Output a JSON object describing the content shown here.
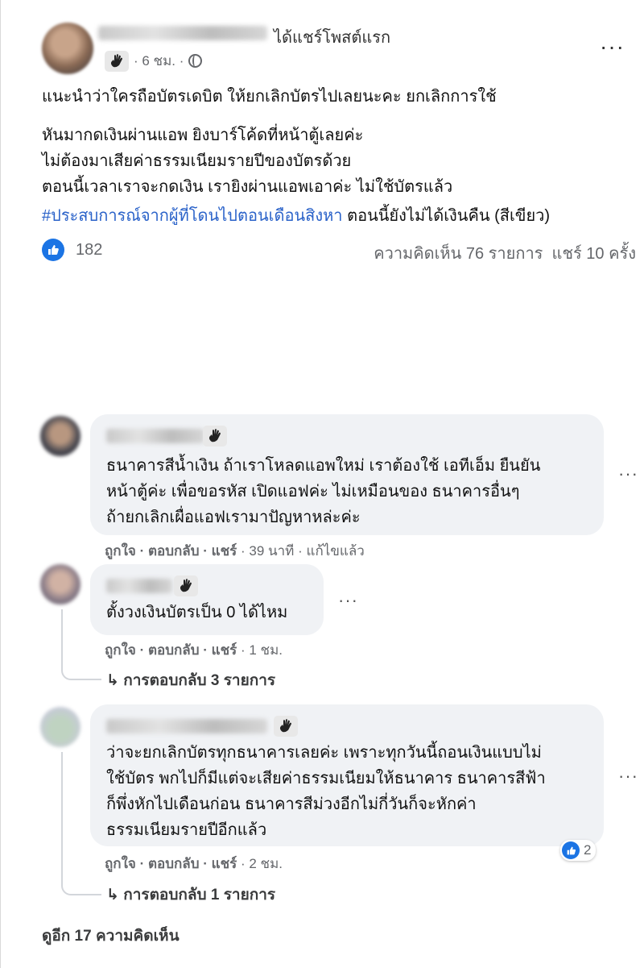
{
  "post": {
    "shared_text": "ได้แชร์โพสต์แรก",
    "time": "· 6 ชม. ·",
    "body_line1": "แนะนำว่าใครถือบัตรเดบิต ให้ยกเลิกบัตรไปเลยนะคะ ยกเลิกการใช้",
    "body_line2": "หันมากดเงินผ่านแอพ ยิงบาร์โค้ดที่หน้าตู้เลยค่ะ",
    "body_line3": "ไม่ต้องมาเสียค่าธรรมเนียมรายปีของบัตรด้วย",
    "body_line4": "ตอนนี้เวลาเราจะกดเงิน เรายิงผ่านแอพเอาค่ะ ไม่ใช้บัตรแล้ว",
    "hashtag": "#ประสบการณ์จากผู้ที่โดนไปตอนเดือนสิงหา",
    "hashtag_tail": " ตอนนี้ยังไม่ได้เงินคืน (สีเขียว)",
    "like_count": "182",
    "comment_count": "ความคิดเห็น 76 รายการ",
    "share_count": "แชร์ 10 ครั้ง",
    "menu": "···"
  },
  "comments": [
    {
      "line1": "ธนาคารสีน้ำเงิน ถ้าเราโหลดแอพใหม่ เราต้องใช้ เอทีเอ็ม ยืนยัน",
      "line2": "หน้าตู้ค่ะ เพื่อขอรหัส เปิดแอฟค่ะ ไม่เหมือนของ ธนาคารอื่นๆ",
      "line3": "ถ้ายกเลิกเผื่อแอฟเรามาปัญหาหล่ะค่ะ",
      "like": "ถูกใจ",
      "reply": "ตอบกลับ",
      "share": "แชร์",
      "time": "· 39 นาที · แก้ไขแล้ว",
      "menu": "···"
    },
    {
      "line1": "ตั้งวงเงินบัตรเป็น 0 ได้ไหม",
      "like": "ถูกใจ",
      "reply": "ตอบกลับ",
      "share": "แชร์",
      "time": "· 1 ชม.",
      "replies": "การตอบกลับ 3 รายการ",
      "menu": "···"
    },
    {
      "line1": "ว่าจะยกเลิกบัตรทุกธนาคารเลยค่ะ เพราะทุกวันนี้ถอนเงินแบบไม่",
      "line2": "ใช้บัตร พกไปก็มีแต่จะเสียค่าธรรมเนียมให้ธนาคาร ธนาคารสีฟ้า",
      "line3": "ก็พึ่งหักไปเดือนก่อน ธนาคารสีม่วงอีกไม่กี่วันก็จะหักค่า",
      "line4": "ธรรมเนียมรายปีอีกแล้ว",
      "reaction_count": "2",
      "like": "ถูกใจ",
      "reply": "ตอบกลับ",
      "share": "แชร์",
      "time": "· 2 ชม.",
      "replies": "การตอบกลับ 1 รายการ",
      "menu": "···"
    }
  ],
  "more_comments": "ดูอีก 17 ความคิดเห็น",
  "colors": {
    "accent": "#1b74e4",
    "hashtag": "#2a62c9",
    "bubble": "#f0f2f5",
    "meta": "#65676b"
  }
}
